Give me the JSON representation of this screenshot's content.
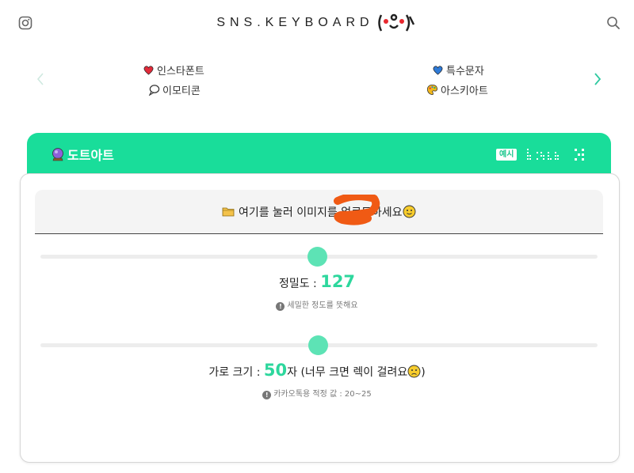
{
  "header": {
    "logo_text": "SNS.KEYBOARD",
    "instagram_icon": "instagram-icon",
    "search_icon": "search-icon"
  },
  "nav": {
    "items": [
      {
        "icon": "red-heart-icon",
        "label": "인스타폰트"
      },
      {
        "icon": "speech-bubble-icon",
        "label": "이모티콘"
      },
      {
        "icon": "blue-heart-icon",
        "label": "특수문자"
      },
      {
        "icon": "art-palette-icon",
        "label": "아스키아트"
      }
    ]
  },
  "section": {
    "title": "도트아트",
    "example_badge": "예시"
  },
  "upload": {
    "label": "여기를 눌러 이미지를 업로드하세요"
  },
  "sliders": {
    "precision": {
      "label": "정밀도 : ",
      "value": "127",
      "hint": "세밀한 정도를 뜻해요"
    },
    "width": {
      "label": "가로 크기 : ",
      "value": "50",
      "suffix": "자 (너무 크면 렉이 걸려요",
      "closing": ")",
      "hint": "카카오톡용 적정 값 : 20~25"
    }
  },
  "colors": {
    "accent": "#19dd9a",
    "slider_thumb": "#5de3b5",
    "number": "#2dd79d"
  }
}
